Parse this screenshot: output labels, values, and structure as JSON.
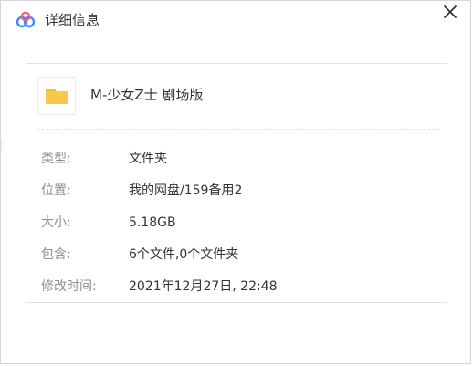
{
  "window": {
    "title": "详细信息",
    "icon": "baidu-netdisk-cloud-icon",
    "close_icon": "close-icon"
  },
  "item": {
    "name": "M-少女Z士 剧场版",
    "icon": "folder-icon"
  },
  "details": {
    "type_label": "类型:",
    "type_value": "文件夹",
    "location_label": "位置:",
    "location_value": "我的网盘/159备用2",
    "size_label": "大小:",
    "size_value": "5.18GB",
    "contains_label": "包含:",
    "contains_value": "6个文件,0个文件夹",
    "modified_label": "修改时间:",
    "modified_value": "2021年12月27日, 22:48"
  },
  "colors": {
    "folder_yellow": "#f6c94b",
    "folder_tab": "#f2bd36",
    "cloud_blue": "#3d8bff",
    "cloud_red": "#ff5a5a",
    "label_gray": "#909090",
    "text_dark": "#333333"
  }
}
